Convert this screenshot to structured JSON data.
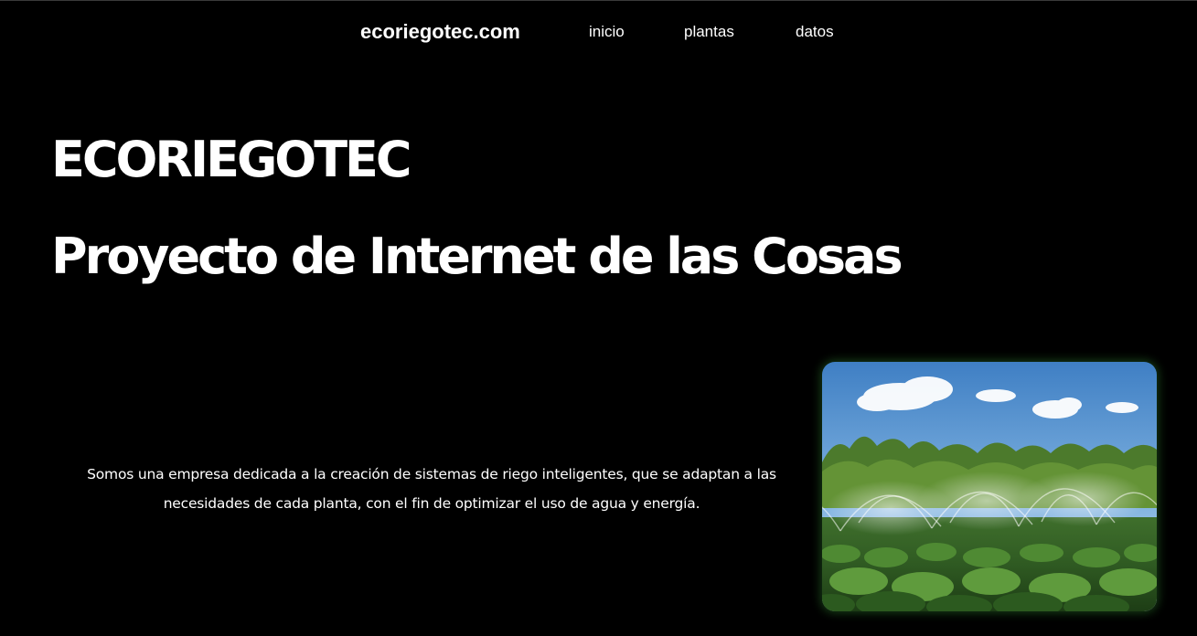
{
  "navbar": {
    "brand": "ecoriegotec.com",
    "links": [
      {
        "label": "inicio"
      },
      {
        "label": "plantas"
      },
      {
        "label": "datos"
      }
    ]
  },
  "hero": {
    "title": "ECORIEGOTEC",
    "subtitle": "Proyecto de Internet de las Cosas"
  },
  "about": {
    "text": "Somos una empresa dedicada a la creación de sistemas de riego inteligentes, que se adaptan a las necesidades de cada planta, con el fin de optimizar el uso de agua y energía."
  },
  "colors": {
    "background": "#000000",
    "text": "#ffffff",
    "image_glow": "#2a6e2a"
  }
}
